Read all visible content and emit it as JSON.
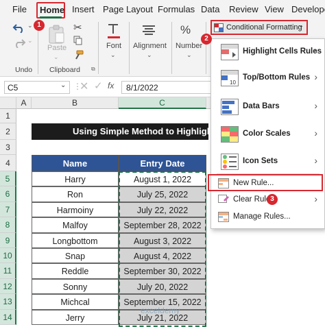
{
  "menu": {
    "tabs": [
      "File",
      "Home",
      "Insert",
      "Page Layout",
      "Formulas",
      "Data",
      "Review",
      "View",
      "Develope"
    ]
  },
  "ribbon": {
    "undo_group_label": "Undo",
    "paste_label": "Paste",
    "clipboard_group_label": "Clipboard",
    "font_label": "Font",
    "alignment_label": "Alignment",
    "number_label": "Number",
    "percent_symbol": "%",
    "conditional_formatting_label": "Conditional Formatting"
  },
  "formula_bar": {
    "name_box": "C5",
    "fx": "fx",
    "value": "8/1/2022"
  },
  "sheet": {
    "columns": [
      "A",
      "B",
      "C"
    ],
    "rows": [
      "1",
      "2",
      "3",
      "4",
      "5",
      "6",
      "7",
      "8",
      "9",
      "10",
      "11",
      "12",
      "13",
      "14"
    ],
    "title": "Using Simple Method to Highlight",
    "headers": [
      "Name",
      "Entry Date"
    ],
    "data": [
      [
        "Harry",
        "August 1, 2022"
      ],
      [
        "Ron",
        "July 25, 2022"
      ],
      [
        "Harmoiny",
        "July 22, 2022"
      ],
      [
        "Malfoy",
        "September 28, 2022"
      ],
      [
        "Longbottom",
        "August 3, 2022"
      ],
      [
        "Snap",
        "August 4, 2022"
      ],
      [
        "Reddle",
        "September 30, 2022"
      ],
      [
        "Sonny",
        "July 20, 2022"
      ],
      [
        "Michcal",
        "September 15, 2022"
      ],
      [
        "Jerry",
        "July 21, 2022"
      ]
    ],
    "watermark": "exceldemy"
  },
  "dropdown": {
    "items": [
      {
        "label": "Highlight Cells Rules",
        "icon": "highlight-cells-icon"
      },
      {
        "label": "Top/Bottom Rules",
        "icon": "top-bottom-icon"
      },
      {
        "label": "Data Bars",
        "icon": "data-bars-icon"
      },
      {
        "label": "Color Scales",
        "icon": "color-scales-icon"
      },
      {
        "label": "Icon Sets",
        "icon": "icon-sets-icon"
      }
    ],
    "new_rule": "New Rule...",
    "clear_rules": "Clear Rules",
    "manage_rules": "Manage Rules..."
  },
  "badges": [
    "1",
    "2",
    "3"
  ],
  "colors": {
    "accent_red": "#d7272f",
    "excel_green": "#1e7145",
    "header_blue": "#2e5496",
    "title_black": "#1c1c1c"
  }
}
